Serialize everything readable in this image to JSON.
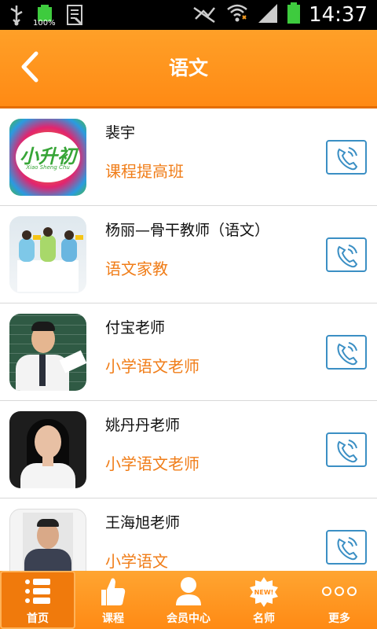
{
  "status_bar": {
    "time": "14:37",
    "battery_percent": "100%"
  },
  "header": {
    "title": "语文"
  },
  "list": [
    {
      "name": "裴宇",
      "subtitle": "课程提高班",
      "logo_text": "小升初",
      "logo_subtext": "Xiao Sheng Chu"
    },
    {
      "name": "杨丽—骨干教师（语文）",
      "subtitle": "语文家教"
    },
    {
      "name": "付宝老师",
      "subtitle": "小学语文老师"
    },
    {
      "name": "姚丹丹老师",
      "subtitle": "小学语文老师"
    },
    {
      "name": "王海旭老师",
      "subtitle": "小学语文"
    }
  ],
  "tabbar": {
    "tabs": [
      {
        "label": "首页"
      },
      {
        "label": "课程"
      },
      {
        "label": "会员中心"
      },
      {
        "label": "名师",
        "badge": "NEW!"
      },
      {
        "label": "更多"
      }
    ]
  },
  "colors": {
    "accent": "#ff8a14",
    "subtitle": "#f07d18",
    "call_border": "#3b8fc4"
  }
}
